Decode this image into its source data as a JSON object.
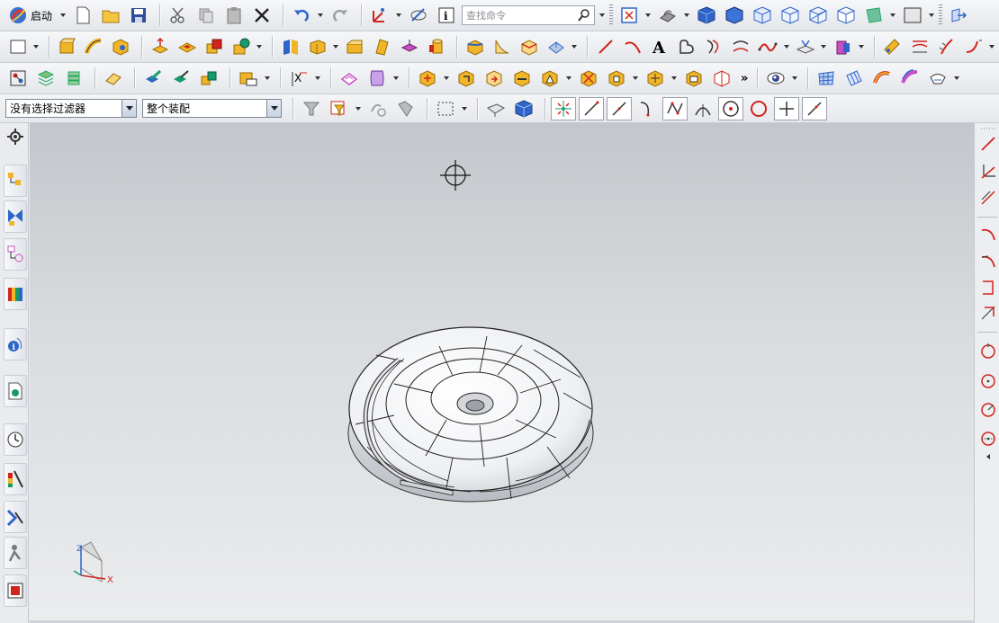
{
  "toolbar": {
    "start_label": "启动",
    "search_placeholder": "查找命令",
    "overflow_mark": "»"
  },
  "selection_bar": {
    "filter_value": "没有选择过滤器",
    "scope_value": "整个装配"
  },
  "viewport": {
    "triad_labels": {
      "z": "Z",
      "x": "X"
    }
  },
  "colors": {
    "accent_red": "#d1241c",
    "accent_blue": "#2f65c9",
    "icon_yellow": "#f0b529",
    "model_surface": "#f2f3f5"
  }
}
